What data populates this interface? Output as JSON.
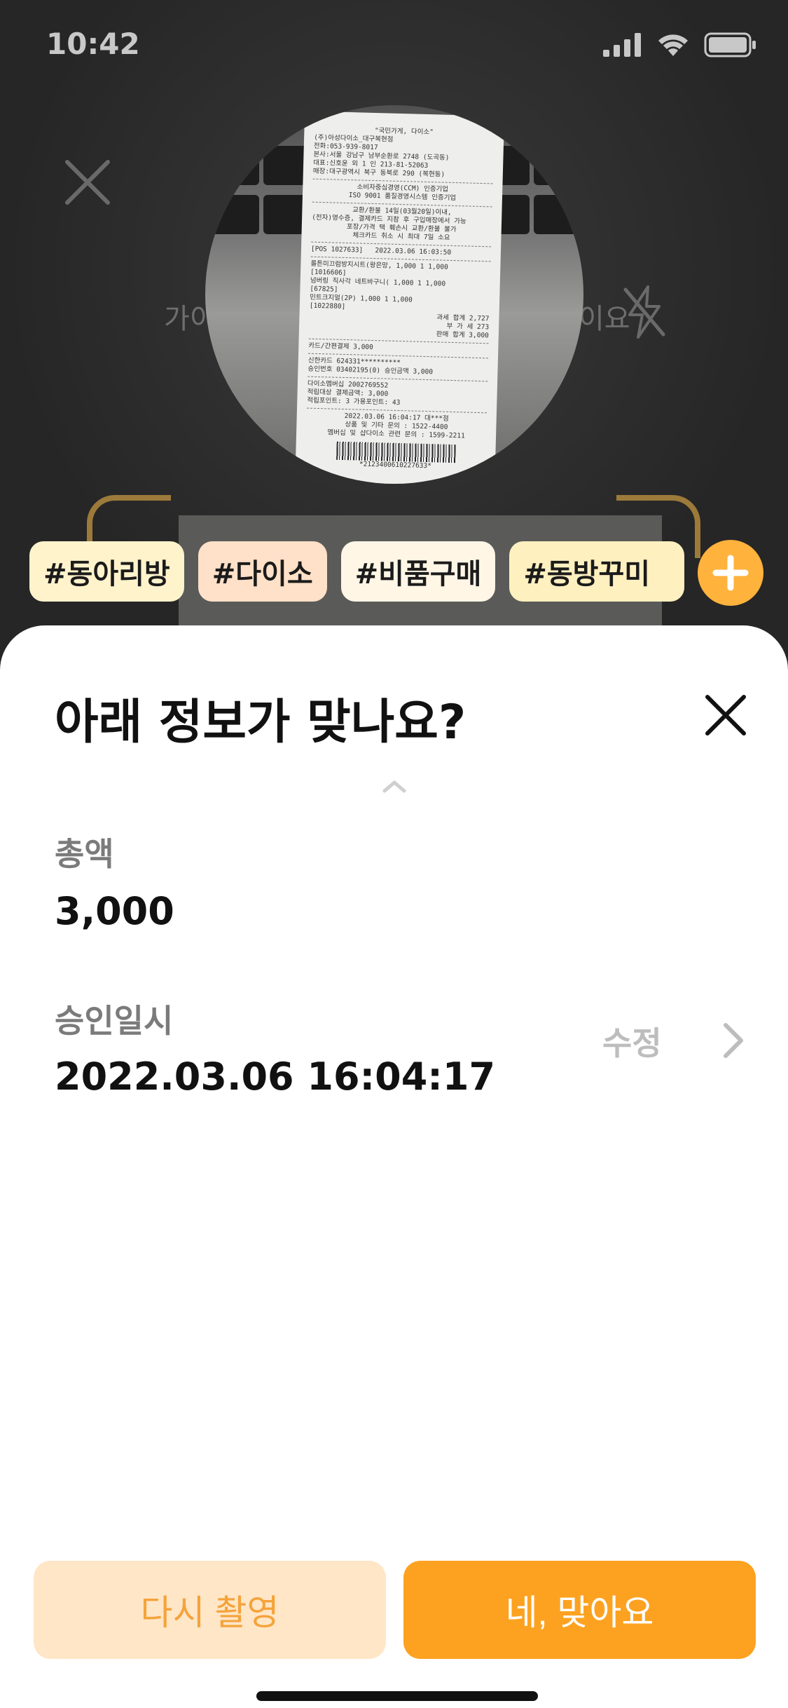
{
  "status_bar": {
    "time": "10:42"
  },
  "camera": {
    "guide_left": "가이",
    "guide_right": "이요"
  },
  "receipt_text": {
    "store": "\"국민가게, 다이소\"",
    "company": "(주)아성다이소_대구복현점",
    "phone": "전화:053-939-8017",
    "ceo": "본사:서울 강남구 남부순환로 2748 (도곡동)",
    "biz": "대표:신호윤 외 1 인 213-81-52063",
    "address": "매장:대구광역시 북구 동북로 290 (복현동)",
    "cert1": "소비자중심경영(CCM) 인증기업",
    "cert2": "ISO 9001 품질경영시스템 인증기업",
    "refund1": "교환/환불 14일(03월20일)이내,",
    "refund2": "(전자)영수증, 결제카드 지참 후 구입매장에서 가능",
    "refund3": "포장/가격 택 훼손시 교환/환불 불가",
    "refund4": "체크카드 취소 시 최대 7일 소요",
    "pos": "[POS 1027633]",
    "pos_time": "2022.03.06 16:03:50",
    "items": [
      {
        "name": "롤튼미끄럼방지시트(왕은망,",
        "qty": "1,000   1   1,000"
      },
      {
        "name": "[1016606]",
        "qty": ""
      },
      {
        "name": "넘버링 직사각 네트바구니(",
        "qty": "1,000   1   1,000"
      },
      {
        "name": "[67825]",
        "qty": ""
      },
      {
        "name": "민트크지얼(2P)",
        "qty": "1,000   1   1,000"
      },
      {
        "name": "[1022880]",
        "qty": ""
      }
    ],
    "subtotal": "과세 합계          2,727",
    "vat": "부 가 세            273",
    "sale_total": "판매 합계          3,000",
    "card_label": "카드/간편결제                   3,000",
    "card_name": "신한카드          624331**********",
    "approval": "승인번호 03402195(0)    승인금액 3,000",
    "member": "다이소멤버십              2002769552",
    "points_base": "적립대상 결제금액: 3,000",
    "points": "적립포인트: 3          가용포인트: 43",
    "footer_time": "2022.03.06 16:04:17 대***점",
    "footer1": "상품 및 기타 문의 : 1522-4400",
    "footer2": "멤버십 및 샵다이소 관련 문의 : 1599-2211",
    "barcode": "*2123400610227633*"
  },
  "tags": [
    "#동아리방",
    "#다이소",
    "#비품구매",
    "#동방꾸미"
  ],
  "sheet": {
    "title": "아래 정보가 맞나요?",
    "total_label": "총액",
    "total_value": "3,000",
    "datetime_label": "승인일시",
    "datetime_value": "2022.03.06 16:04:17",
    "edit_label": "수정",
    "retake_label": "다시 촬영",
    "confirm_label": "네, 맞아요"
  },
  "colors": {
    "accent": "#fda220",
    "accent_light": "#ffe6c7",
    "dark_bg": "#2b2b2b"
  },
  "icons": [
    "signal-icon",
    "wifi-icon",
    "battery-icon",
    "close-icon",
    "flash-off-icon",
    "plus-icon",
    "chevron-up-icon",
    "chevron-right-icon"
  ]
}
